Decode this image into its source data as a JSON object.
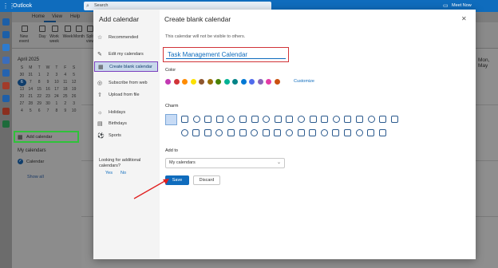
{
  "app": {
    "name": "Outlook",
    "search_placeholder": "Search",
    "meet_now": "Meet Now"
  },
  "ribbon": {
    "tabs": [
      "Home",
      "View",
      "Help"
    ],
    "buttons": [
      "New event",
      "Day",
      "Work week",
      "Week",
      "Month",
      "Split view"
    ]
  },
  "mini_calendar": {
    "month": "April 2025",
    "weekdays": [
      "S",
      "M",
      "T",
      "W",
      "T",
      "F",
      "S"
    ],
    "rows": [
      [
        "30",
        "31",
        "1",
        "2",
        "3",
        "4",
        "5"
      ],
      [
        "6",
        "7",
        "8",
        "9",
        "10",
        "11",
        "12"
      ],
      [
        "13",
        "14",
        "15",
        "16",
        "17",
        "18",
        "19"
      ],
      [
        "20",
        "21",
        "22",
        "23",
        "24",
        "25",
        "26"
      ],
      [
        "27",
        "28",
        "29",
        "30",
        "1",
        "2",
        "3"
      ],
      [
        "4",
        "5",
        "6",
        "7",
        "8",
        "9",
        "10"
      ]
    ]
  },
  "left_pane": {
    "add_calendar": "Add calendar",
    "my_calendars": "My calendars",
    "calendar": "Calendar",
    "show_all": "Show all"
  },
  "background": {
    "month_label": "Mon, May"
  },
  "dialog": {
    "nav_title": "Add calendar",
    "nav_items": [
      {
        "label": "Recommended",
        "icon": "star-icon"
      },
      {
        "label": "Edit my calendars",
        "icon": "edit-icon"
      },
      {
        "label": "Create blank calendar",
        "icon": "calendar-add-icon"
      },
      {
        "label": "Subscribe from web",
        "icon": "globe-icon"
      },
      {
        "label": "Upload from file",
        "icon": "upload-icon"
      },
      {
        "label": "Holidays",
        "icon": "holiday-icon"
      },
      {
        "label": "Birthdays",
        "icon": "birthday-icon"
      },
      {
        "label": "Sports",
        "icon": "sports-icon"
      }
    ],
    "looking_for": "Looking for additional calendars?",
    "yes": "Yes",
    "no": "No",
    "title": "Create blank calendar",
    "subtitle": "This calendar will not be visible to others.",
    "calendar_name": "Task Management Calendar",
    "color_label": "Color",
    "colors": [
      "#c239b3",
      "#d13438",
      "#ff8c00",
      "#fce100",
      "#8e562e",
      "#986f0b",
      "#498205",
      "#00b294",
      "#038387",
      "#0078d4",
      "#4f6bed",
      "#8764b8",
      "#e43ba6",
      "#ca5010"
    ],
    "customize": "Customize",
    "charm_label": "Charm",
    "add_to_label": "Add to",
    "add_to_value": "My calendars",
    "save": "Save",
    "discard": "Discard"
  }
}
